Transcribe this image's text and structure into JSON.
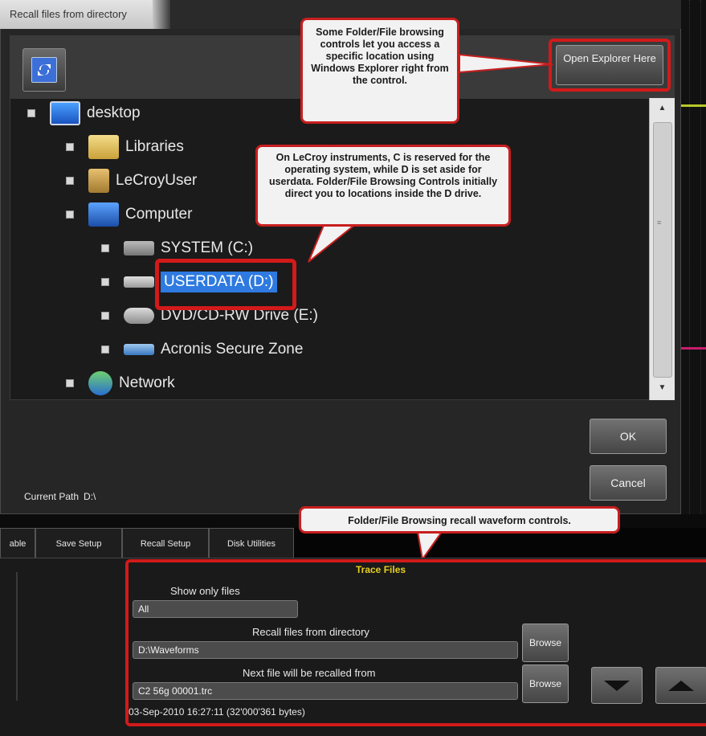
{
  "dialog": {
    "title": "Recall files from directory",
    "open_explorer_label": "Open Explorer Here",
    "ok_label": "OK",
    "cancel_label": "Cancel",
    "current_path_label": "Current Path",
    "current_path_value": "D:\\"
  },
  "tree": {
    "items": [
      {
        "label": "desktop",
        "icon": "desktop-icon"
      },
      {
        "label": "Libraries",
        "icon": "libraries-folder-icon"
      },
      {
        "label": "LeCroyUser",
        "icon": "user-folder-icon"
      },
      {
        "label": "Computer",
        "icon": "computer-icon"
      },
      {
        "label": "SYSTEM (C:)",
        "icon": "system-drive-icon"
      },
      {
        "label": "USERDATA (D:)",
        "icon": "drive-icon",
        "selected": true
      },
      {
        "label": "DVD/CD-RW Drive (E:)",
        "icon": "dvd-drive-icon"
      },
      {
        "label": "Acronis Secure Zone",
        "icon": "acronis-zone-icon"
      },
      {
        "label": "Network",
        "icon": "network-icon"
      }
    ]
  },
  "callouts": {
    "explorer": "Some Folder/File browsing controls let you access a specific location using Windows Explorer right from the control.",
    "drives": "On LeCroy instruments, C is reserved for the operating system, while D is set aside for userdata. Folder/File Browsing Controls initially direct you to locations inside the D drive.",
    "recall": "Folder/File Browsing recall waveform controls."
  },
  "tabs": [
    "able",
    "Save Setup",
    "Recall Setup",
    "Disk Utilities"
  ],
  "trace_files": {
    "title": "Trace Files",
    "show_only_label": "Show only files",
    "show_only_value": "All",
    "recall_dir_label": "Recall files from directory",
    "recall_dir_value": "D:\\Waveforms",
    "next_file_label": "Next file will be recalled from",
    "next_file_value": "C2 56g 00001.trc",
    "browse_label": "Browse",
    "status": "03-Sep-2010 16:27:11 (32'000'361 bytes)"
  },
  "colors": {
    "highlight_red": "#d21a1a",
    "selection_blue": "#2e7ae0",
    "group_title_yellow": "#e8d020",
    "trace_yellow": "#b8c82a",
    "trace_magenta": "#c81c6c"
  }
}
